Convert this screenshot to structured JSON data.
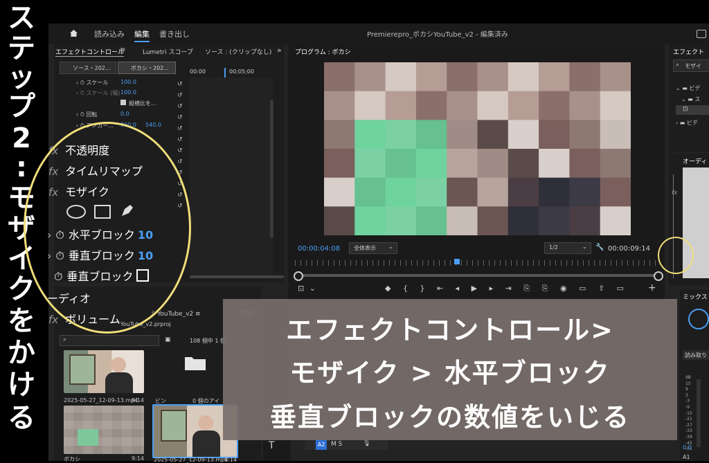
{
  "side_caption": [
    "ス",
    "テ",
    "ッ",
    "プ",
    "2",
    ":",
    "モ",
    "ザ",
    "イ",
    "ク",
    "を",
    "か",
    "け",
    "る"
  ],
  "topbar": {
    "menu": [
      "読み込み",
      "編集",
      "書き出し"
    ],
    "title": "Premierepro_ボカシYouTube_v2 - 編集済み"
  },
  "effect_controls": {
    "tabs": [
      "エフェクトコントロール",
      "Lumetri スコープ",
      "ソース : (クリップなし)"
    ],
    "clip_tabs": [
      "ソース・202...",
      "ボカシ・202..."
    ],
    "time_marks": [
      "00:00",
      "00;05;00"
    ],
    "rows": [
      {
        "label": "スケール",
        "value": "100.0"
      },
      {
        "label": "スケール (幅)",
        "value": "100.0"
      },
      {
        "label": "縦横比を..."
      },
      {
        "label": "回転",
        "value": "0.0"
      },
      {
        "label": "アンカー...",
        "value": "960.0",
        "value2": "540.0"
      }
    ]
  },
  "overlay_effects": {
    "opacity": "不透明度",
    "time_remap": "タイムリマップ",
    "mosaic": "モザイク",
    "h_blocks": {
      "label": "水平ブロック",
      "value": "10"
    },
    "v_blocks": {
      "label": "垂直ブロック",
      "value": "10"
    },
    "v_blocks2": {
      "label": "垂直ブロック"
    },
    "audio": "ーディオ",
    "volume": "ボリューム"
  },
  "program": {
    "tab": "プログラム : ボカシ",
    "timecode_left": "00:00:04:08",
    "zoom": "全体表示",
    "quality": "1/2",
    "timecode_right": "00:00:09:14"
  },
  "effects_panel": {
    "tab": "エフェクト",
    "search": "モザイ",
    "tree": [
      "ビデ",
      "ス",
      "ビデ"
    ]
  },
  "audio_panel": {
    "tab": "オーディ"
  },
  "mixer": {
    "tab": "ミックス",
    "read": "読み取り",
    "db": [
      "dB",
      "15",
      "9",
      "3",
      "-3",
      "-9",
      "-15",
      "-21",
      "-27",
      "-33",
      "-39",
      "-45",
      "-51"
    ],
    "value": "0.0",
    "channel": "A1"
  },
  "project": {
    "tabs": [
      "シYouTube_v2 ≡",
      "プロ"
    ],
    "file": "YouTube_v2.prproj",
    "count": "108 個中 1 個",
    "items": [
      {
        "name": "2025-05-27_12-09-13.mp4",
        "dur": "9:14"
      },
      {
        "name": "ビン",
        "dur": "0 個のアイ"
      },
      {
        "name": "ボカシ",
        "dur": "9:14"
      },
      {
        "name": "2025-05-27_12-09-13.mp4",
        "dur": "9:14"
      }
    ]
  },
  "timeline": {
    "track": "A2",
    "letters": "M S"
  },
  "banner": {
    "line1": "エフェクトコントロール>",
    "line2": "モザイク > 水平ブロック",
    "line3": "垂直ブロックの数値をいじる"
  }
}
